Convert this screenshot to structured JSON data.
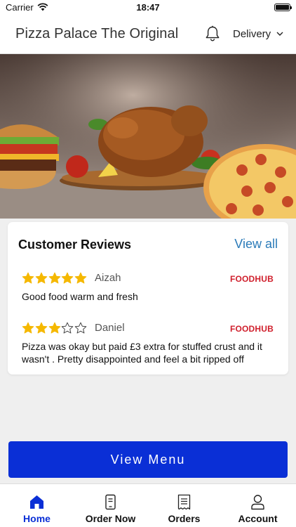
{
  "status_bar": {
    "carrier": "Carrier",
    "time": "18:47"
  },
  "header": {
    "title": "Pizza Palace The Original",
    "delivery_label": "Delivery"
  },
  "reviews": {
    "title": "Customer Reviews",
    "view_all": "View all",
    "items": [
      {
        "rating": 5,
        "max_rating": 5,
        "reviewer": "Aizah",
        "source": "FOODHUB",
        "text": "Good food warm and fresh"
      },
      {
        "rating": 3,
        "max_rating": 5,
        "reviewer": "Daniel",
        "source": "FOODHUB",
        "text": "Pizza was okay but paid £3 extra for stuffed crust and it wasn't . Pretty disappointed and feel a bit ripped off"
      }
    ]
  },
  "view_menu_label": "View Menu",
  "tabs": [
    {
      "label": "Home",
      "icon": "home-icon",
      "active": true
    },
    {
      "label": "Order Now",
      "icon": "order-now-icon",
      "active": false
    },
    {
      "label": "Orders",
      "icon": "orders-receipt-icon",
      "active": false
    },
    {
      "label": "Account",
      "icon": "account-icon",
      "active": false
    }
  ],
  "colors": {
    "primary": "#0a2fd6",
    "star": "#f5b800",
    "link": "#2b7bb9",
    "foodhub": "#d0202d"
  }
}
